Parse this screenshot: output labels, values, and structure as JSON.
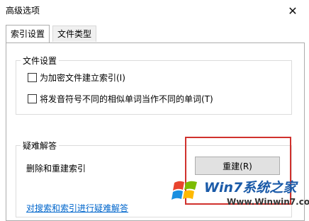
{
  "window": {
    "title": "高级选项",
    "close_icon": "close-icon"
  },
  "tabs": [
    {
      "label": "索引设置",
      "active": true
    },
    {
      "label": "文件类型",
      "active": false
    }
  ],
  "file_settings": {
    "legend": "文件设置",
    "options": [
      {
        "label": "为加密文件建立索引(I)",
        "checked": false
      },
      {
        "label": "将发音符号不同的相似单词当作不同的单词(T)",
        "checked": false
      }
    ]
  },
  "troubleshoot": {
    "legend": "疑难解答",
    "description": "删除和重建索引",
    "rebuild_button": "重建(R)",
    "help_link": "对搜索和索引进行疑难解答"
  },
  "watermark": {
    "brand": "Win7系统之家",
    "url": "Www.Winwin7.com"
  },
  "colors": {
    "highlight": "#d0312d",
    "link": "#0066cc",
    "brand": "#1a5aa8"
  }
}
